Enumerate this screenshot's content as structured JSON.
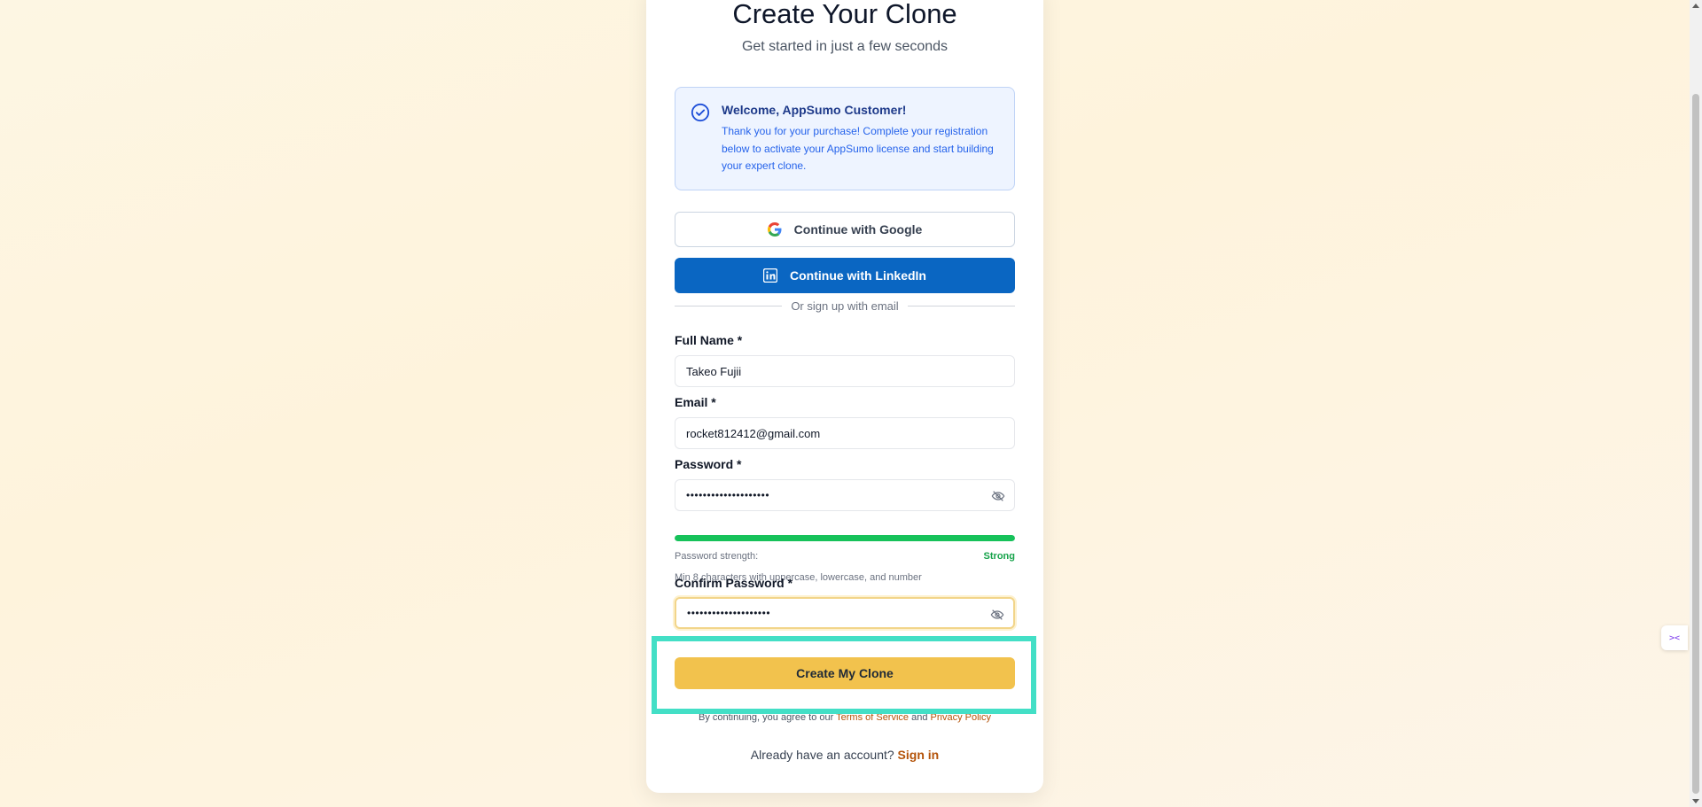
{
  "header": {
    "title": "Create Your Clone",
    "subtitle": "Get started in just a few seconds"
  },
  "welcome": {
    "icon": "check-circle-icon",
    "title": "Welcome, AppSumo Customer!",
    "body": "Thank you for your purchase! Complete your registration below to activate your AppSumo license and start building your expert clone."
  },
  "social": {
    "google_label": "Continue with Google",
    "linkedin_label": "Continue with LinkedIn"
  },
  "divider_text": "Or sign up with email",
  "form": {
    "full_name_label": "Full Name *",
    "full_name_value": "Takeo Fujii",
    "email_label": "Email *",
    "email_value": "rocket812412@gmail.com",
    "password_label": "Password *",
    "password_value": "••••••••••••••••••••",
    "strength_label": "Password strength:",
    "strength_value": "Strong",
    "strength_fraction": 1.0,
    "password_hint": "Min 8 characters with uppercase, lowercase, and number",
    "confirm_label": "Confirm Password *",
    "confirm_value": "••••••••••••••••••••"
  },
  "submit_label": "Create My Clone",
  "terms": {
    "prefix": "By continuing, you agree to our ",
    "terms_link": "Terms of Service",
    "and": " and ",
    "privacy_link": "Privacy Policy"
  },
  "signin": {
    "prompt": "Already have an account? ",
    "link": "Sign in"
  },
  "colors": {
    "accent": "#f2c24d",
    "linkedin": "#0a66c2",
    "strength": "#16c25a",
    "highlight": "#43dfc6"
  }
}
